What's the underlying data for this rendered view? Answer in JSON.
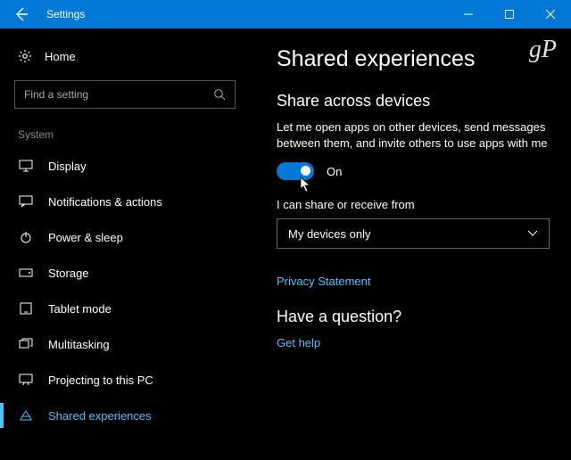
{
  "titlebar": {
    "title": "Settings"
  },
  "sidebar": {
    "home": "Home",
    "search_placeholder": "Find a setting",
    "group": "System",
    "items": [
      {
        "label": "Display"
      },
      {
        "label": "Notifications & actions"
      },
      {
        "label": "Power & sleep"
      },
      {
        "label": "Storage"
      },
      {
        "label": "Tablet mode"
      },
      {
        "label": "Multitasking"
      },
      {
        "label": "Projecting to this PC"
      },
      {
        "label": "Shared experiences"
      }
    ]
  },
  "content": {
    "page_title": "Shared experiences",
    "section_title": "Share across devices",
    "description": "Let me open apps on other devices, send messages between them, and invite others to use apps with me",
    "toggle_state": "On",
    "share_label": "I can share or receive from",
    "dropdown_value": "My devices only",
    "privacy_link": "Privacy Statement",
    "question_title": "Have a question?",
    "help_link": "Get help"
  },
  "watermark": "gP"
}
